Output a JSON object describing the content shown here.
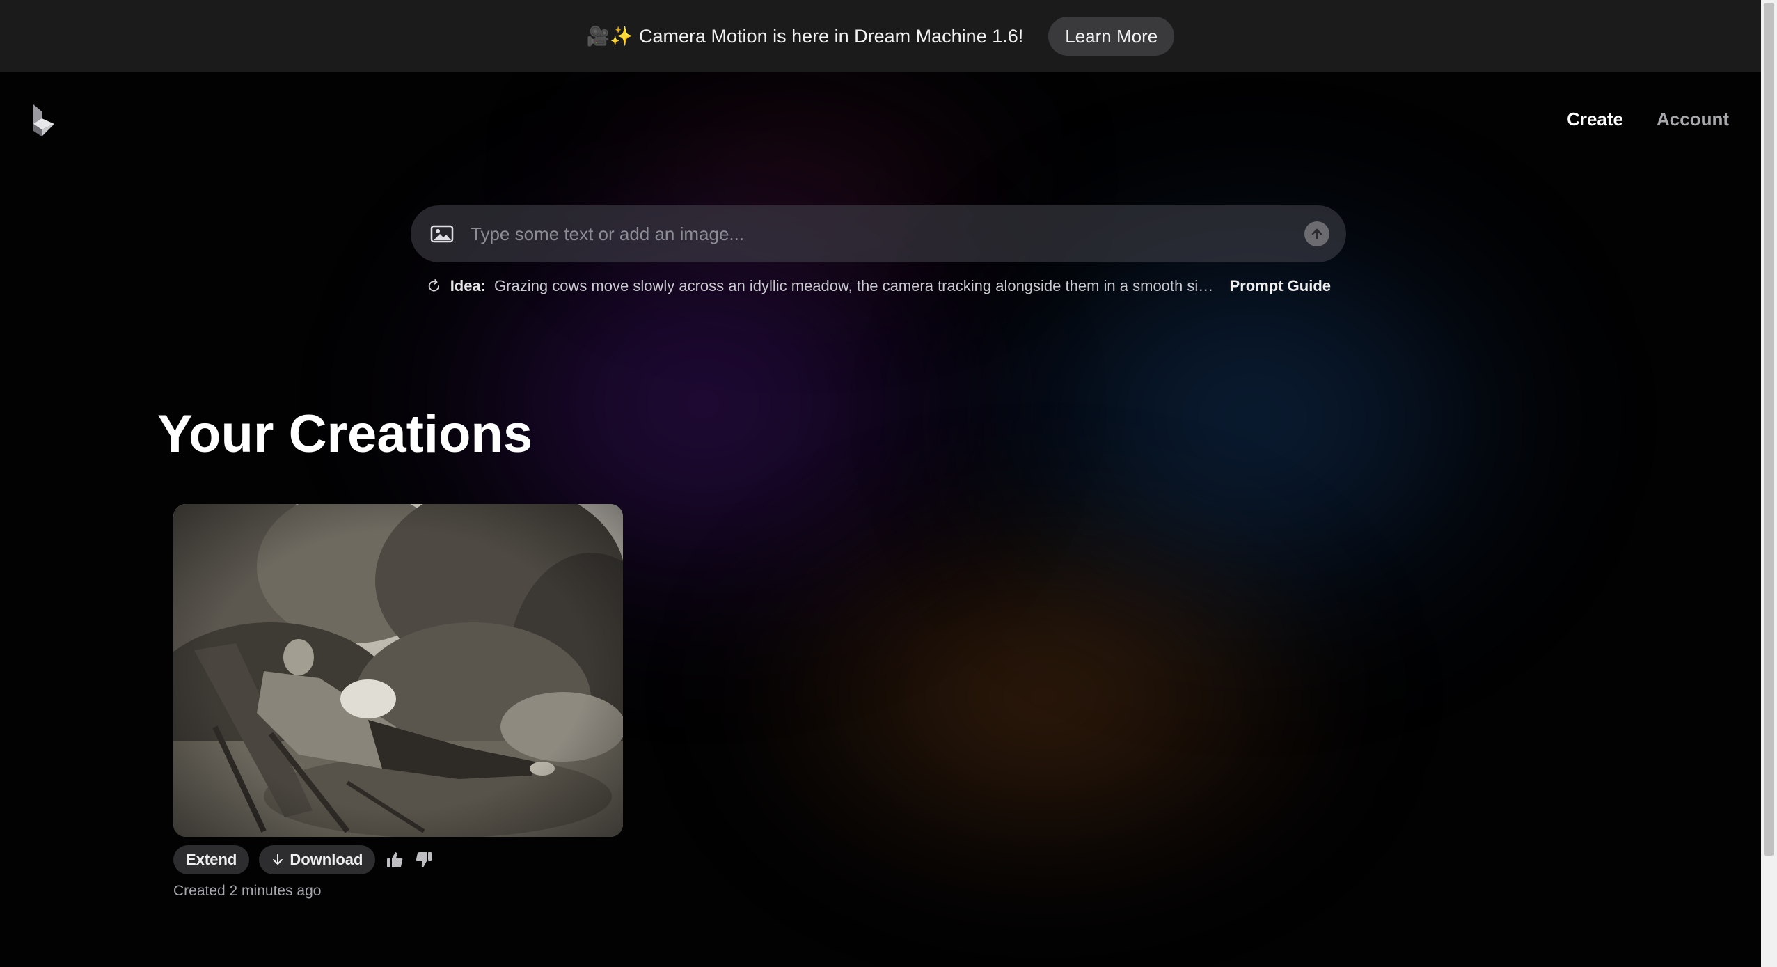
{
  "banner": {
    "emoji": "🎥✨",
    "text": "Camera Motion is here in Dream Machine 1.6!",
    "cta_label": "Learn More"
  },
  "nav": {
    "create_label": "Create",
    "account_label": "Account"
  },
  "prompt": {
    "placeholder": "Type some text or add an image...",
    "value": ""
  },
  "idea": {
    "label": "Idea:",
    "text": "Grazing cows move slowly across an idyllic meadow, the camera tracking alongside them in a smooth side-angl...",
    "guide_label": "Prompt Guide"
  },
  "creations": {
    "title": "Your Creations",
    "items": [
      {
        "extend_label": "Extend",
        "download_label": "Download",
        "created_text": "Created 2 minutes ago"
      }
    ]
  },
  "colors": {
    "banner_bg": "#1b1b1c",
    "page_bg": "#020203",
    "chip_bg": "#2d2d30"
  }
}
